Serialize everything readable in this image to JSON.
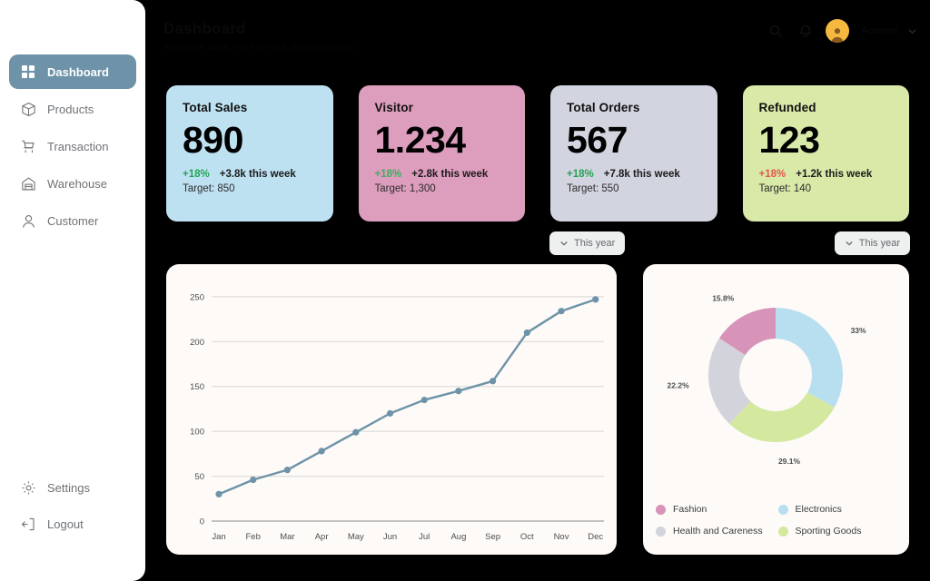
{
  "sidebar": {
    "top_items": [
      {
        "label": "Dashboard",
        "icon": "grid-icon",
        "active": true
      },
      {
        "label": "Products",
        "icon": "box-icon",
        "active": false
      },
      {
        "label": "Transaction",
        "icon": "cart-icon",
        "active": false
      },
      {
        "label": "Warehouse",
        "icon": "warehouse-icon",
        "active": false
      },
      {
        "label": "Customer",
        "icon": "user-icon",
        "active": false
      }
    ],
    "bottom_items": [
      {
        "label": "Settings",
        "icon": "gear-icon",
        "active": false
      },
      {
        "label": "Logout",
        "icon": "logout-icon",
        "active": false
      }
    ],
    "active_color": "#6e93a8"
  },
  "topbar": {
    "title": "Dashboard",
    "subtitle": "Welcome back, here is your store overview",
    "search_icon": "search-icon",
    "notification_icon": "bell-icon",
    "avatar_icon": "avatar",
    "avatar_color": "#f5b942",
    "user_name": "Account",
    "chevron_icon": "chevron-down-icon"
  },
  "cards": [
    {
      "title": "Total Sales",
      "value": "890",
      "delta": "+18%",
      "delta_color": "#23a455",
      "delta_note": "+3.8k this week",
      "target": "Target: 850",
      "bg": "#bee1f2"
    },
    {
      "title": "Visitor",
      "value": "1.234",
      "delta": "+18%",
      "delta_color": "#3fae5e",
      "delta_note": "+2.8k this week",
      "target": "Target: 1,300",
      "bg": "#dd9dbc"
    },
    {
      "title": "Total Orders",
      "value": "567",
      "delta": "+18%",
      "delta_color": "#23a455",
      "delta_note": "+7.8k this week",
      "target": "Target: 550",
      "bg": "#d2d4df"
    },
    {
      "title": "Refunded",
      "value": "123",
      "delta": "+18%",
      "delta_color": "#e8564b",
      "delta_note": "+1.2k this week",
      "target": "Target: 140",
      "bg": "#d8e9a8"
    }
  ],
  "filters": {
    "left_label": "This year",
    "right_label": "This year",
    "chevron_icon": "chevron-down-icon"
  },
  "chart_data": [
    {
      "type": "line",
      "title": "",
      "xlabel": "",
      "ylabel": "",
      "categories": [
        "Jan",
        "Feb",
        "Mar",
        "Apr",
        "May",
        "Jun",
        "Jul",
        "Aug",
        "Sep",
        "Oct",
        "Nov",
        "Dec"
      ],
      "values": [
        30,
        46,
        57,
        78,
        99,
        120,
        135,
        145,
        156,
        210,
        234,
        247
      ],
      "yticks": [
        0,
        50,
        100,
        150,
        200,
        250
      ],
      "ylim": [
        0,
        260
      ],
      "grid": true,
      "legend": "none",
      "line_color": "#6e93a8",
      "marker_color": "#6e93a8",
      "plot_bg": "#fdfaf7"
    },
    {
      "type": "pie",
      "subtype": "donut",
      "title": "",
      "labels": [
        "Electronics",
        "Sporting Goods",
        "Health and Careness",
        "Fashion"
      ],
      "values": [
        33,
        29.1,
        22.2,
        15.8
      ],
      "value_labels": [
        "33%",
        "29.1%",
        "22.2%",
        "15.8%"
      ],
      "colors": [
        "#b8dff0",
        "#d5e8a0",
        "#d3d3dc",
        "#d794b8"
      ],
      "legend_position": "bottom",
      "legend_entries": [
        {
          "label": "Fashion",
          "color": "#d794b8"
        },
        {
          "label": "Electronics",
          "color": "#b8dff0"
        },
        {
          "label": "Health and Careness",
          "color": "#d3d3dc"
        },
        {
          "label": "Sporting Goods",
          "color": "#d5e8a0"
        }
      ]
    }
  ]
}
